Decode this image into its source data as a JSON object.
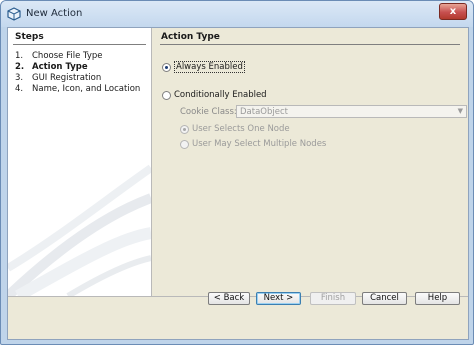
{
  "window": {
    "title": "New Action",
    "close_glyph": "x"
  },
  "steps": {
    "heading": "Steps",
    "items": [
      {
        "num": "1.",
        "label": "Choose File Type"
      },
      {
        "num": "2.",
        "label": "Action Type"
      },
      {
        "num": "3.",
        "label": "GUI Registration"
      },
      {
        "num": "4.",
        "label": "Name, Icon, and Location"
      }
    ],
    "current_index": 1
  },
  "action_type": {
    "heading": "Action Type",
    "always_enabled_label": "Always Enabled",
    "conditionally_enabled_label": "Conditionally Enabled",
    "selected": "Always Enabled",
    "cookie_class_label": "Cookie Class:",
    "cookie_class_value": "DataObject",
    "user_selects_one_label": "User Selects One Node",
    "user_selects_multiple_label": "User May Select Multiple Nodes"
  },
  "buttons": {
    "back": "< Back",
    "next": "Next >",
    "finish": "Finish",
    "cancel": "Cancel",
    "help": "Help"
  },
  "colors": {
    "window_frame": "#bfd4ea",
    "dialog_background": "#ece9d8",
    "close_button": "#c75050"
  }
}
